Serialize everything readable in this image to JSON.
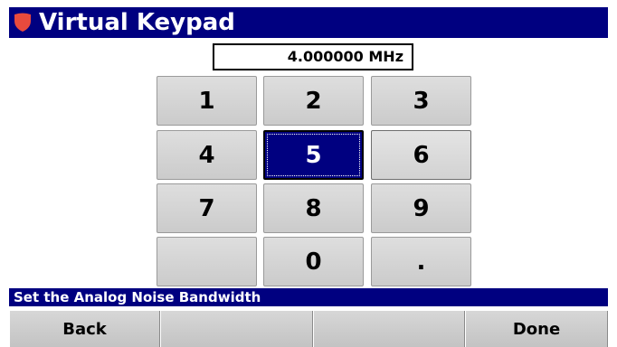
{
  "title": "Virtual Keypad",
  "display_value": "4.000000 MHz",
  "keys": [
    "1",
    "2",
    "3",
    "4",
    "5",
    "6",
    "7",
    "8",
    "9",
    "",
    "0",
    "."
  ],
  "selected_key": "5",
  "status": "Set the Analog Noise Bandwidth",
  "softkeys": [
    "Back",
    "",
    "",
    "Done"
  ],
  "colors": {
    "title_bar": "#000080",
    "status_bar": "#000080",
    "logo": "#e84a3d",
    "selected_key": "#000080"
  },
  "icons": {
    "logo": "shield-logo-icon"
  }
}
